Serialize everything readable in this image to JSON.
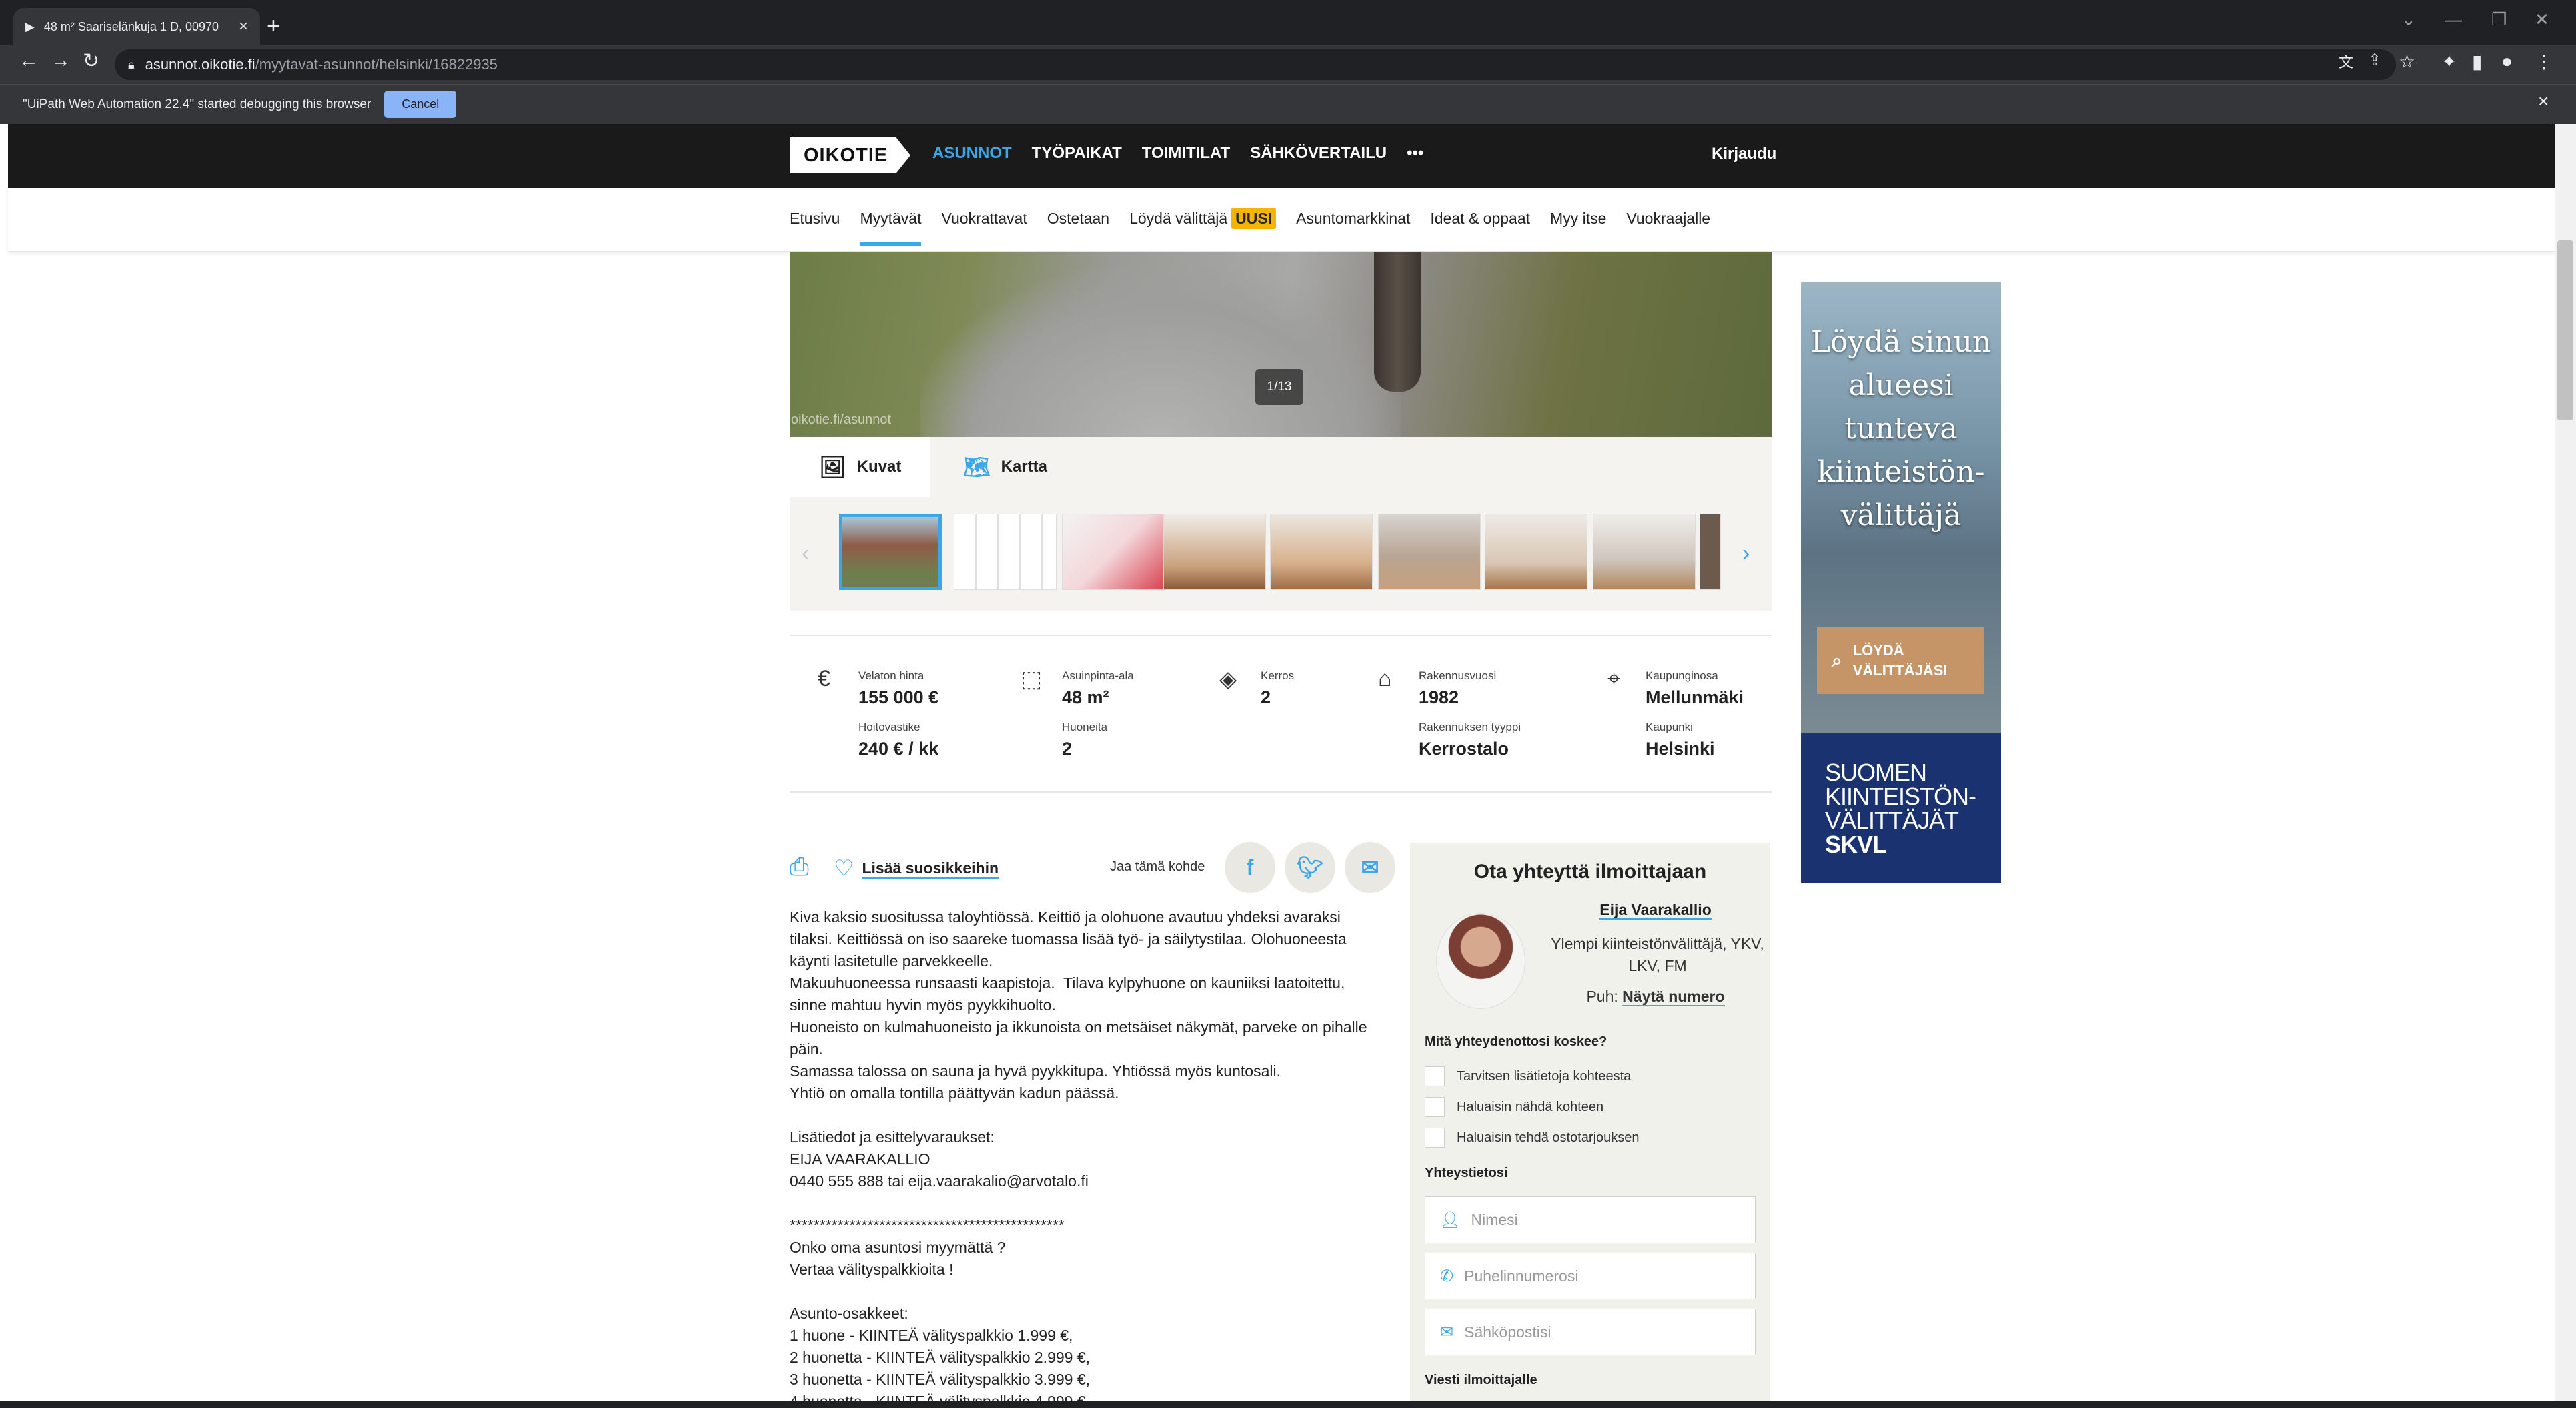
{
  "browser": {
    "tab_title": "48 m² Saariselänkuja 1 D, 00970",
    "url_host": "asunnot.oikotie.fi",
    "url_path": "/myytavat-asunnot/helsinki/16822935",
    "debug_message": "\"UiPath Web Automation 22.4\" started debugging this browser",
    "debug_cancel": "Cancel"
  },
  "header": {
    "logo": "OIKOTIE",
    "nav": [
      {
        "label": "ASUNNOT",
        "active": true
      },
      {
        "label": "TYÖPAIKAT"
      },
      {
        "label": "TOIMITILAT"
      },
      {
        "label": "SÄHKÖVERTAILU"
      },
      {
        "label": "•••"
      }
    ],
    "login": "Kirjaudu"
  },
  "subnav": {
    "items": [
      "Etusivu",
      "Myytävät",
      "Vuokrattavat",
      "Ostetaan",
      "Löydä välittäjä",
      "Asuntomarkkinat",
      "Ideat & oppaat",
      "Myy itse",
      "Vuokraajalle"
    ],
    "badge": "UUSI"
  },
  "gallery": {
    "watermark": "oikotie.fi/asunnot",
    "counter": "1/13",
    "tabs": [
      "Kuvat",
      "Kartta"
    ]
  },
  "facts": {
    "price_label": "Velaton hinta",
    "price_value": "155 000 €",
    "fee_label": "Hoitovastike",
    "fee_value": "240 € / kk",
    "area_label": "Asuinpinta-ala",
    "area_value": "48 m²",
    "rooms_label": "Huoneita",
    "rooms_value": "2",
    "floor_label": "Kerros",
    "floor_value": "2",
    "year_label": "Rakennusvuosi",
    "year_value": "1982",
    "type_label": "Rakennuksen tyyppi",
    "type_value": "Kerrostalo",
    "district_label": "Kaupunginosa",
    "district_value": "Mellunmäki",
    "city_label": "Kaupunki",
    "city_value": "Helsinki"
  },
  "actions": {
    "favorite": "Lisää suosikkeihin",
    "share_label": "Jaa tämä kohde"
  },
  "description": "Kiva kaksio suositussa taloyhtiössä. Keittiö ja olohuone avautuu yhdeksi avaraksi\ntilaksi. Keittiössä on iso saareke tuomassa lisää työ- ja säilytystilaa. Olohuoneesta\nkäynti lasitetulle parvekkeelle.\nMakuuhuoneessa runsaasti kaapistoja.  Tilava kylpyhuone on kauniiksi laatoitettu,\nsinne mahtuu hyvin myös pyykkihuolto.\nHuoneisto on kulmahuoneisto ja ikkunoista on metsäiset näkymät, parveke on pihalle\npäin.\nSamassa talossa on sauna ja hyvä pyykkitupa. Yhtiössä myös kuntosali.\nYhtiö on omalla tontilla päättyvän kadun päässä.\n\nLisätiedot ja esittelyvaraukset:\nEIJA VAARAKALLIO\n0440 555 888 tai eija.vaarakalio@arvotalo.fi\n\n**********************************************\nOnko oma asuntosi myymättä ?\nVertaa välityspalkkioita !\n\nAsunto-osakkeet:\n1 huone - KIINTEÄ välityspalkkio 1.999 €,\n2 huonetta - KIINTEÄ välityspalkkio 2.999 €,\n3 huonetta - KIINTEÄ välityspalkkio 3.999 €,\n4 huonetta - KIINTEÄ välityspalkkio 4.999 €",
  "contact": {
    "title": "Ota yhteyttä ilmoittajaan",
    "agent_name": "Eija Vaarakallio",
    "agent_title": "Ylempi kiinteistönvälittäjä, YKV, LKV, FM",
    "phone_prefix": "Puh:",
    "phone_link": "Näytä numero",
    "question": "Mitä yhteydenottosi koskee?",
    "options": [
      "Tarvitsen lisätietoja kohteesta",
      "Haluaisin nähdä kohteen",
      "Haluaisin tehdä ostotarjouksen"
    ],
    "info_label": "Yhteystietosi",
    "name_placeholder": "Nimesi",
    "phone_placeholder": "Puhelinnumerosi",
    "email_placeholder": "Sähköpostisi",
    "message_label": "Viesti ilmoittajalle"
  },
  "ad": {
    "headline": "Löydä sinun alueesi tunteva kiinteistön-välittäjä",
    "button": "LÖYDÄ VÄLITTÄJÄSI",
    "org_line1": "SUOMEN",
    "org_line2": "KIINTEISTÖN-",
    "org_line3": "VÄLITTÄJÄT",
    "org_brand": "SKVL"
  },
  "colors": {
    "accent": "#3ba6e8",
    "header_bg": "#1a1a1a",
    "badge": "#f4b400",
    "ad_button": "#c69567",
    "ad_navy": "#1b3271"
  }
}
